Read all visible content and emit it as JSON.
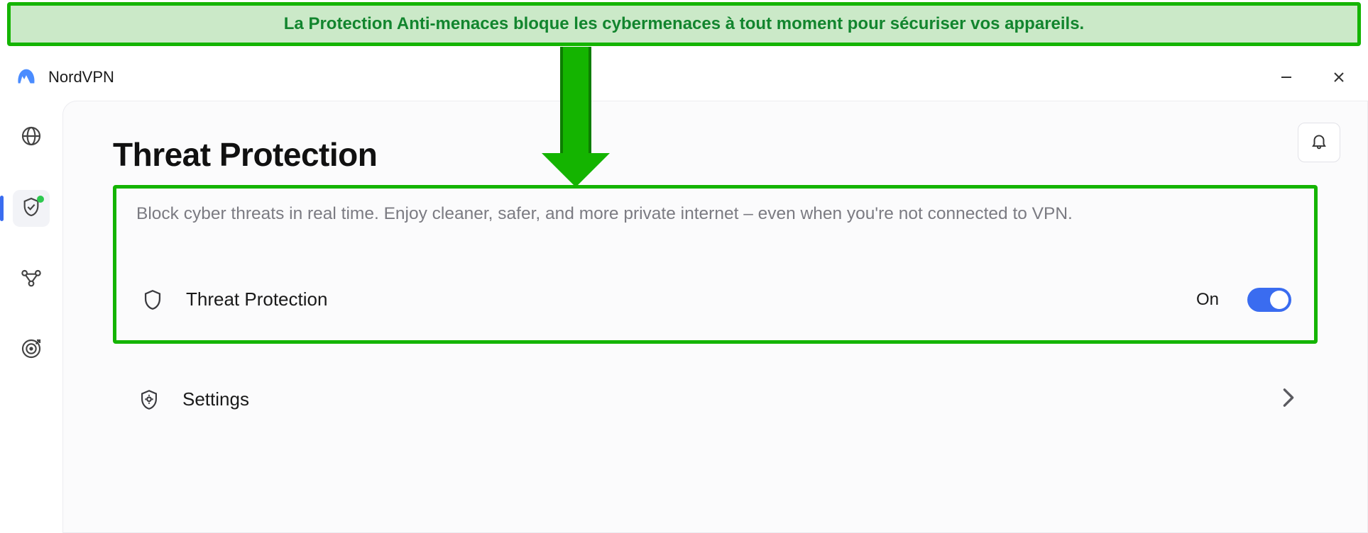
{
  "callout": {
    "text": "La Protection Anti-menaces bloque les cybermenaces à tout moment pour sécuriser vos appareils."
  },
  "app": {
    "name": "NordVPN"
  },
  "sidebar": {
    "items": [
      {
        "name": "globe"
      },
      {
        "name": "shield",
        "active": true
      },
      {
        "name": "mesh"
      },
      {
        "name": "target"
      }
    ]
  },
  "page": {
    "title": "Threat Protection",
    "description": "Block cyber threats in real time. Enjoy cleaner, safer, and more private internet – even when you're not connected to VPN."
  },
  "threat_row": {
    "label": "Threat Protection",
    "state": "On"
  },
  "settings_row": {
    "label": "Settings"
  }
}
